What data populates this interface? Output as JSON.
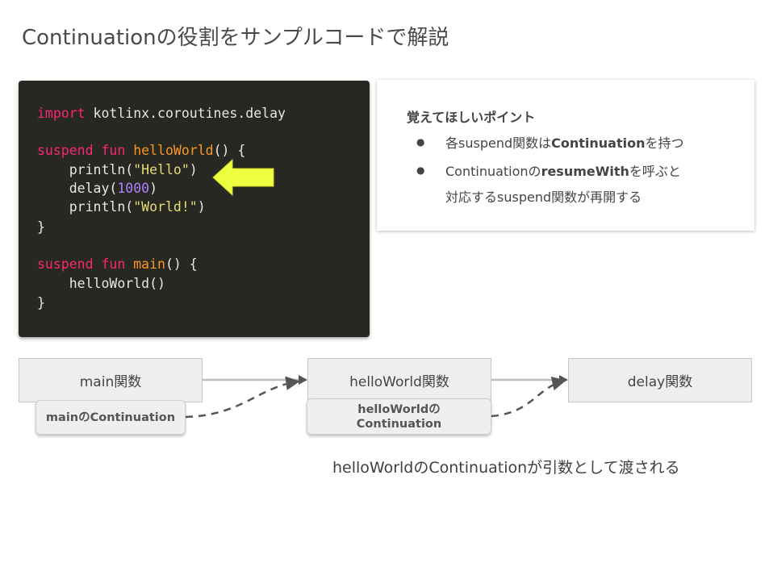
{
  "title": "Continuationの役割をサンプルコードで解説",
  "code": {
    "line1_kw": "import",
    "line1_rest": " kotlinx.coroutines.delay",
    "line2_kw": "suspend fun",
    "line2_fn": "helloWorld",
    "line2_rest": "() {",
    "line3_pre": "    println(",
    "line3_str": "\"Hello\"",
    "line3_post": ")",
    "line4_pre": "    delay(",
    "line4_num": "1000",
    "line4_post": ")",
    "line5_pre": "    println(",
    "line5_str": "\"World!\"",
    "line5_post": ")",
    "line6": "}",
    "line7_kw": "suspend fun",
    "line7_fn": "main",
    "line7_rest": "() {",
    "line8": "    helloWorld()",
    "line9": "}",
    "highlight_color": "#eeff41"
  },
  "points": {
    "heading": "覚えてほしいポイント",
    "bullet": "●",
    "item1_a": "各suspend関数は",
    "item1_b": "Continuation",
    "item1_c": "を持つ",
    "item2_a": "Continuationの",
    "item2_b": "resumeWith",
    "item2_c": "を呼ぶと",
    "item2_d": "対応するsuspend関数が再開する"
  },
  "diagram": {
    "main_fn": "main関数",
    "hello_fn": "helloWorld関数",
    "delay_fn": "delay関数",
    "main_cont": "mainのContinuation",
    "hello_cont_line1": "helloWorldの",
    "hello_cont_line2": "Continuation",
    "caption": "helloWorldのContinuationが引数として渡される"
  }
}
